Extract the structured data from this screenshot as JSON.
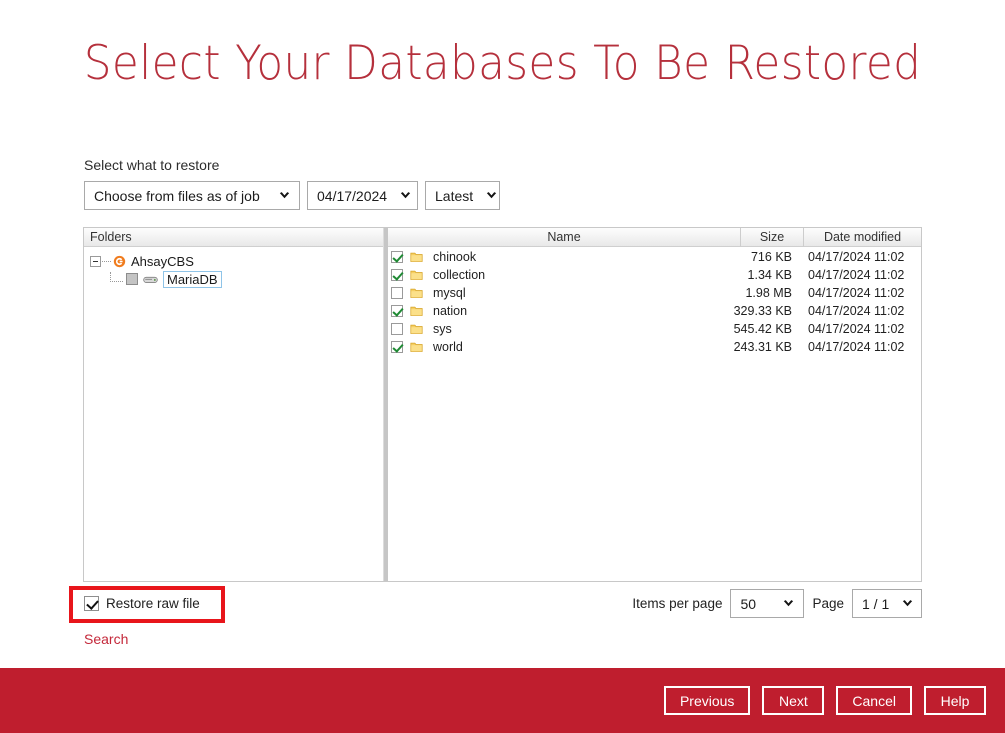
{
  "page": {
    "title": "Select Your Databases To Be Restored"
  },
  "restore": {
    "label": "Select what to restore",
    "job_source": "Choose from files as of job",
    "date": "04/17/2024",
    "version": "Latest"
  },
  "tree": {
    "header": "Folders",
    "root": {
      "label": "AhsayCBS",
      "icon": "ahsay-logo-icon",
      "expanded": true
    },
    "children": [
      {
        "label": "MariaDB",
        "icon": "database-icon",
        "checked": false,
        "selected": true
      }
    ]
  },
  "file_list": {
    "columns": [
      "Name",
      "Size",
      "Date modified"
    ],
    "rows": [
      {
        "name": "chinook",
        "size": "716 KB",
        "date": "04/17/2024 11:02",
        "checked": true,
        "icon": "folder-icon"
      },
      {
        "name": "collection",
        "size": "1.34 KB",
        "date": "04/17/2024 11:02",
        "checked": true,
        "icon": "folder-icon"
      },
      {
        "name": "mysql",
        "size": "1.98 MB",
        "date": "04/17/2024 11:02",
        "checked": false,
        "icon": "folder-icon"
      },
      {
        "name": "nation",
        "size": "329.33 KB",
        "date": "04/17/2024 11:02",
        "checked": true,
        "icon": "folder-icon"
      },
      {
        "name": "sys",
        "size": "545.42 KB",
        "date": "04/17/2024 11:02",
        "checked": false,
        "icon": "folder-icon"
      },
      {
        "name": "world",
        "size": "243.31 KB",
        "date": "04/17/2024 11:02",
        "checked": true,
        "icon": "folder-icon"
      }
    ]
  },
  "options": {
    "restore_raw_file_label": "Restore raw file",
    "restore_raw_file_checked": true,
    "search_label": "Search"
  },
  "pagination": {
    "items_per_page_label": "Items per page",
    "items_per_page_value": "50",
    "page_label": "Page",
    "page_value": "1 / 1"
  },
  "footer": {
    "previous": "Previous",
    "next": "Next",
    "cancel": "Cancel",
    "help": "Help"
  },
  "colors": {
    "title_red": "#b5303c",
    "footer_red": "#bf1e2e",
    "link_red": "#c4283a",
    "highlight_red": "#e8151b",
    "check_green": "#1f8a34",
    "folder_gold": "#f3c34b"
  }
}
